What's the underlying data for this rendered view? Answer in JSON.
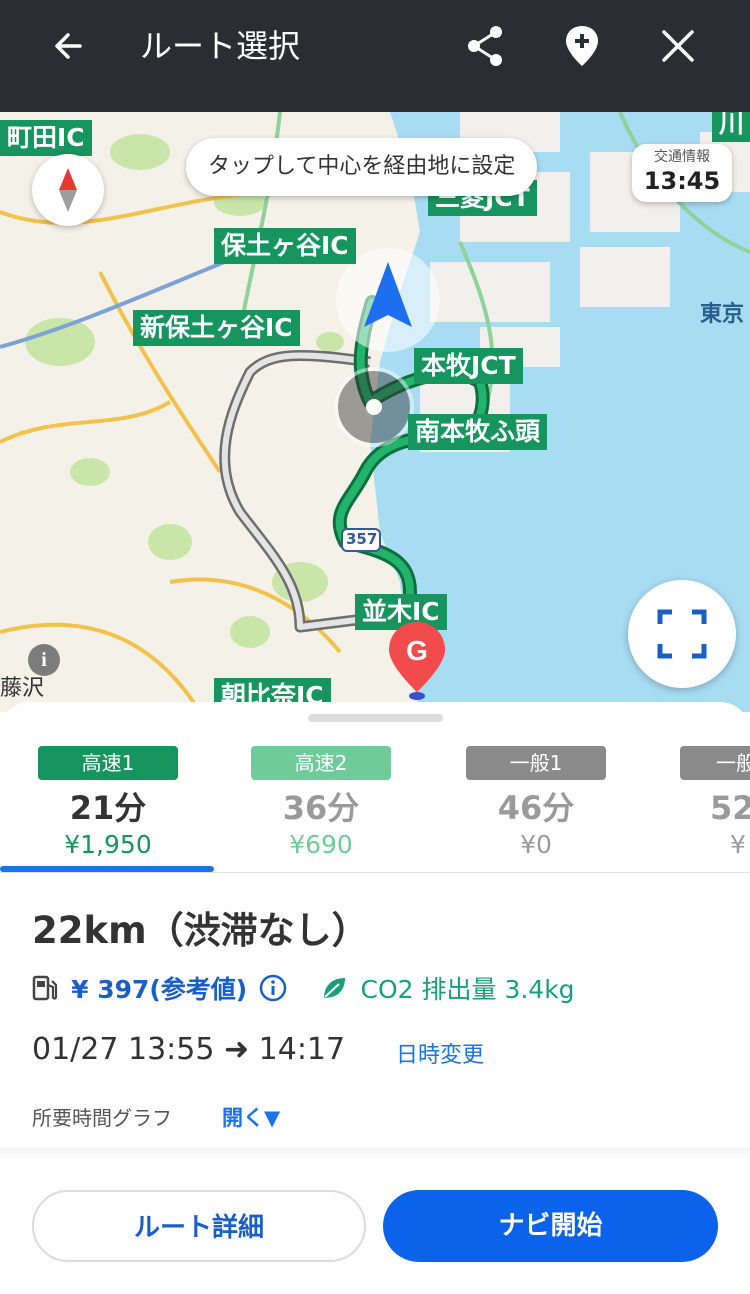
{
  "header": {
    "title": "ルート選択"
  },
  "map": {
    "tooltip": "タップして中心を経由地に設定",
    "traffic_label": "交通情報",
    "traffic_time": "13:45",
    "road_shield": "357",
    "goal_marker": "G",
    "labels": {
      "machida_ic": "町田IC",
      "kawa": "川",
      "hodogaya_ic": "保土ヶ谷IC",
      "shin_hodogaya_ic": "新保土ヶ谷IC",
      "mitsubishi_jct": "三菱JCT",
      "honmoku_jct": "本牧JCT",
      "minami_honmoku": "南本牧ふ頭",
      "namiki_ic": "並木IC",
      "asahina_ic": "朝比奈IC"
    },
    "place_tokyo": "東京",
    "place_fujisawa": "藤沢"
  },
  "routes": [
    {
      "badge": "高速1",
      "time": "21分",
      "price": "¥1,950",
      "badge_color": "#17955e",
      "text_color": "#333333",
      "price_color": "#17955e"
    },
    {
      "badge": "高速2",
      "time": "36分",
      "price": "¥690",
      "badge_color": "#6fcb9a",
      "text_color": "#9a9a9a",
      "price_color": "#6fcb9a"
    },
    {
      "badge": "一般1",
      "time": "46分",
      "price": "¥0",
      "badge_color": "#8a8a8a",
      "text_color": "#9a9a9a",
      "price_color": "#9a9a9a"
    },
    {
      "badge": "一般",
      "time": "52",
      "price": "¥",
      "badge_color": "#8a8a8a",
      "text_color": "#9a9a9a",
      "price_color": "#9a9a9a"
    }
  ],
  "detail": {
    "distance": "22km（渋滞なし）",
    "fuel_cost": "¥ 397(参考値)",
    "co2": "CO2 排出量 3.4kg",
    "datetime": "01/27  13:55 ➜ 14:17",
    "change_datetime": "日時変更",
    "graph_label": "所要時間グラフ",
    "graph_toggle": "開く▼"
  },
  "buttons": {
    "route_detail": "ルート詳細",
    "start_navi": "ナビ開始"
  },
  "colors": {
    "header_bg": "#2b2d32",
    "accent_blue": "#0a63ea",
    "route_green": "#17955e",
    "sea_blue": "#a8dcf3"
  }
}
